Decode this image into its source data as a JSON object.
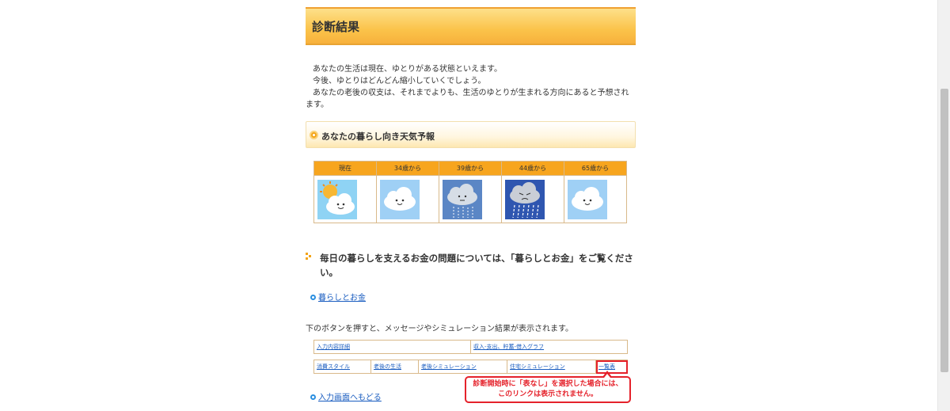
{
  "result": {
    "title": "診断結果",
    "lines": [
      "あなたの生活は現在、ゆとりがある状態といえます。",
      "今後、ゆとりはどんどん縮小していくでしょう。",
      "あなたの老後の収支は、それまでよりも、生活のゆとりが生まれる方向にあると予想されます。"
    ]
  },
  "forecast": {
    "title": "あなたの暮らし向き天気予報",
    "columns": [
      {
        "label": "現在",
        "icon": "sun-cloud-icon"
      },
      {
        "label": "34歳から",
        "icon": "cloud-icon"
      },
      {
        "label": "39歳から",
        "icon": "light-rain-icon"
      },
      {
        "label": "44歳から",
        "icon": "heavy-rain-icon"
      },
      {
        "label": "65歳から",
        "icon": "cloud-icon"
      }
    ]
  },
  "advice": {
    "text": "毎日の暮らしを支えるお金の問題については、「暮らしとお金」をご覧ください。",
    "link": "暮らしとお金"
  },
  "info": "下のボタンを押すと、メッセージやシミュレーション結果が表示されます。",
  "buttons": {
    "row1": [
      "入力内容詳細",
      "収入-支出、貯蓄-借入グラフ"
    ],
    "row2": [
      "消費スタイル",
      "老後の生活",
      "老後シミュレーション",
      "住宅シミュレーション",
      "一覧表"
    ]
  },
  "callout": {
    "line1": "診断開始時に「表なし」を選択した場合には、",
    "line2": "このリンクは表示されません。"
  },
  "back_link": "入力画面へもどる",
  "colors": {
    "accent": "#f7a51e",
    "link": "#1a5dc0",
    "alert": "#e5222b"
  }
}
